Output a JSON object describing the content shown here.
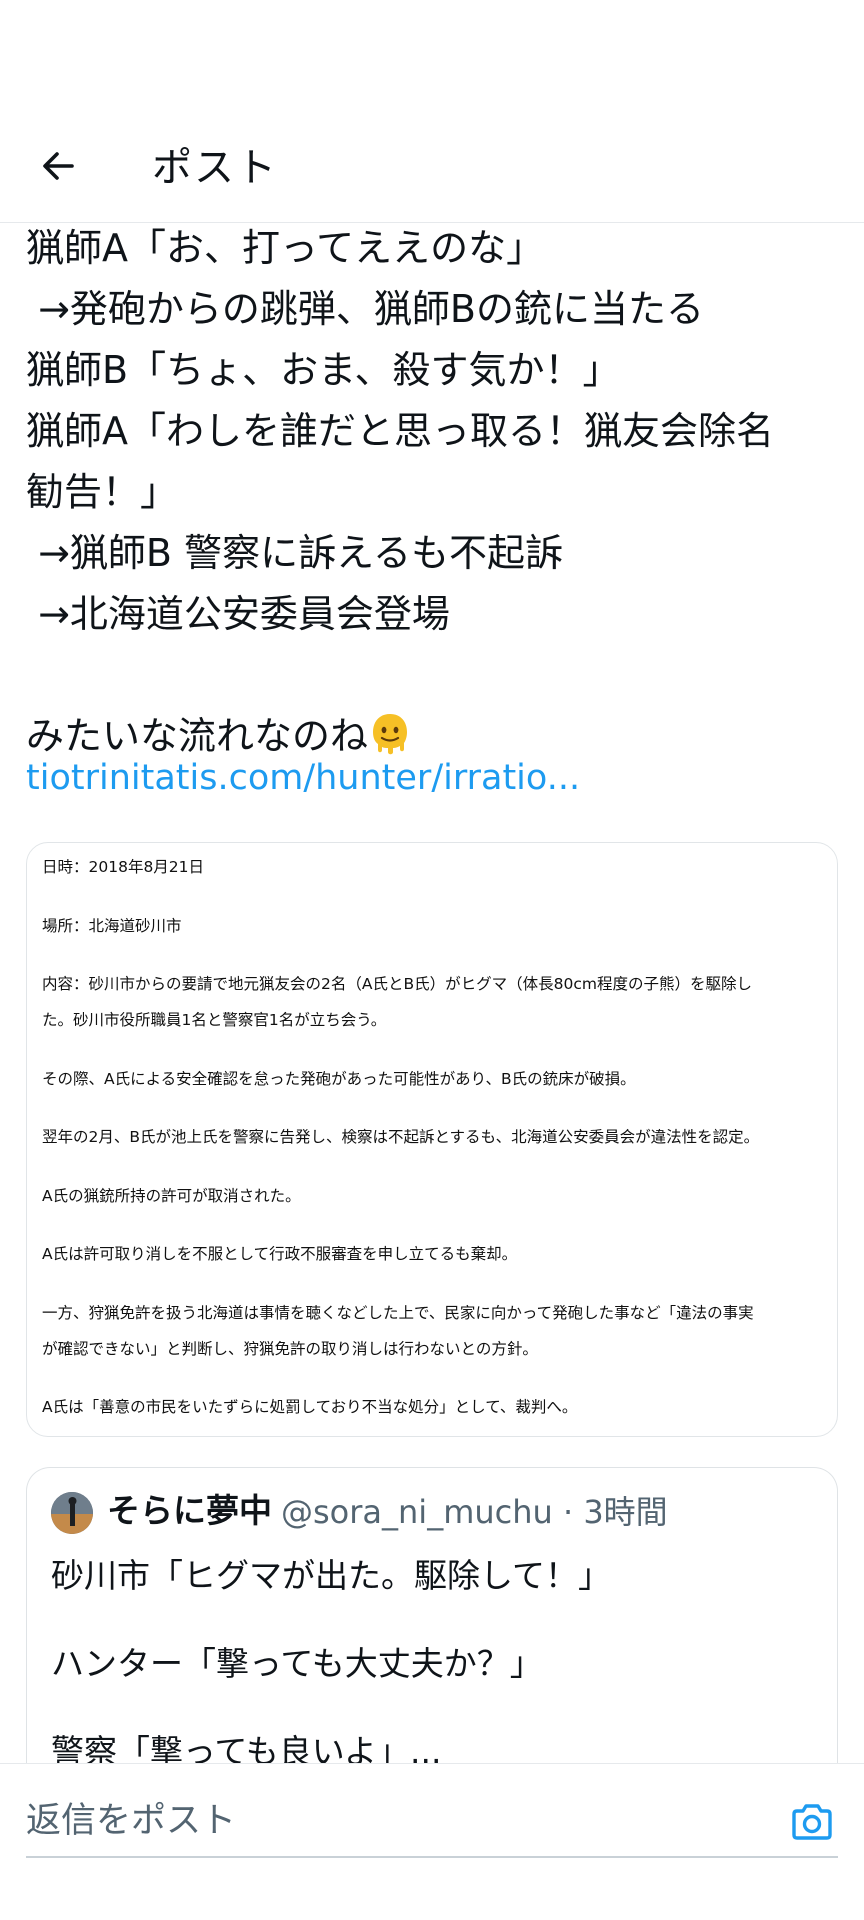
{
  "header": {
    "title": "ポスト"
  },
  "tweet": {
    "text": "猟師A「お、打ってええのな」\n →発砲からの跳弾、猟師Bの銃に当たる\n猟師B「ちょ、おま、殺す気か！」\n猟師A「わしを誰だと思っ取る！猟友会除名\n勧告！」\n →猟師B 警察に訴えるも不起訴\n →北海道公安委員会登場\n\nみたいな流れなのね",
    "emoji": "melting-face",
    "link": "tiotrinitatis.com/hunter/irratio..."
  },
  "image_card": {
    "lines": [
      "日時：2018年8月21日",
      "場所：北海道砂川市",
      "内容：砂川市からの要請で地元猟友会の2名（A氏とB氏）がヒグマ（体長80cm程度の子熊）を駆除し",
      "た。砂川市役所職員1名と警察官1名が立ち会う。",
      "その際、A氏による安全確認を怠った発砲があった可能性があり、B氏の銃床が破損。",
      "翌年の2月、B氏が池上氏を警察に告発し、検察は不起訴とするも、北海道公安委員会が違法性を認定。",
      "A氏の猟銃所持の許可が取消された。",
      "A氏は許可取り消しを不服として行政不服審査を申し立てるも棄却。",
      "一方、狩猟免許を扱う北海道は事情を聴くなどした上で、民家に向かって発砲した事など「違法の事実",
      "が確認できない」と判断し、狩猟免許の取り消しは行わないとの方針。",
      "A氏は「善意の市民をいたずらに処罰しており不当な処分」として、裁判へ。"
    ]
  },
  "quote": {
    "name": "そらに夢中",
    "handle": "@sora_ni_muchu · 3時間",
    "text": "砂川市「ヒグマが出た。駆除して！」\n\nハンター「撃っても大丈夫か？」\n\n警察「撃っても良いよ」..."
  },
  "reply": {
    "placeholder": "返信をポスト"
  },
  "colors": {
    "link": "#1d9bf0",
    "text": "#0f1419",
    "muted": "#536471",
    "border": "#e1e5e8"
  },
  "icons": {
    "back": "arrow-left-icon",
    "camera": "camera-icon"
  }
}
